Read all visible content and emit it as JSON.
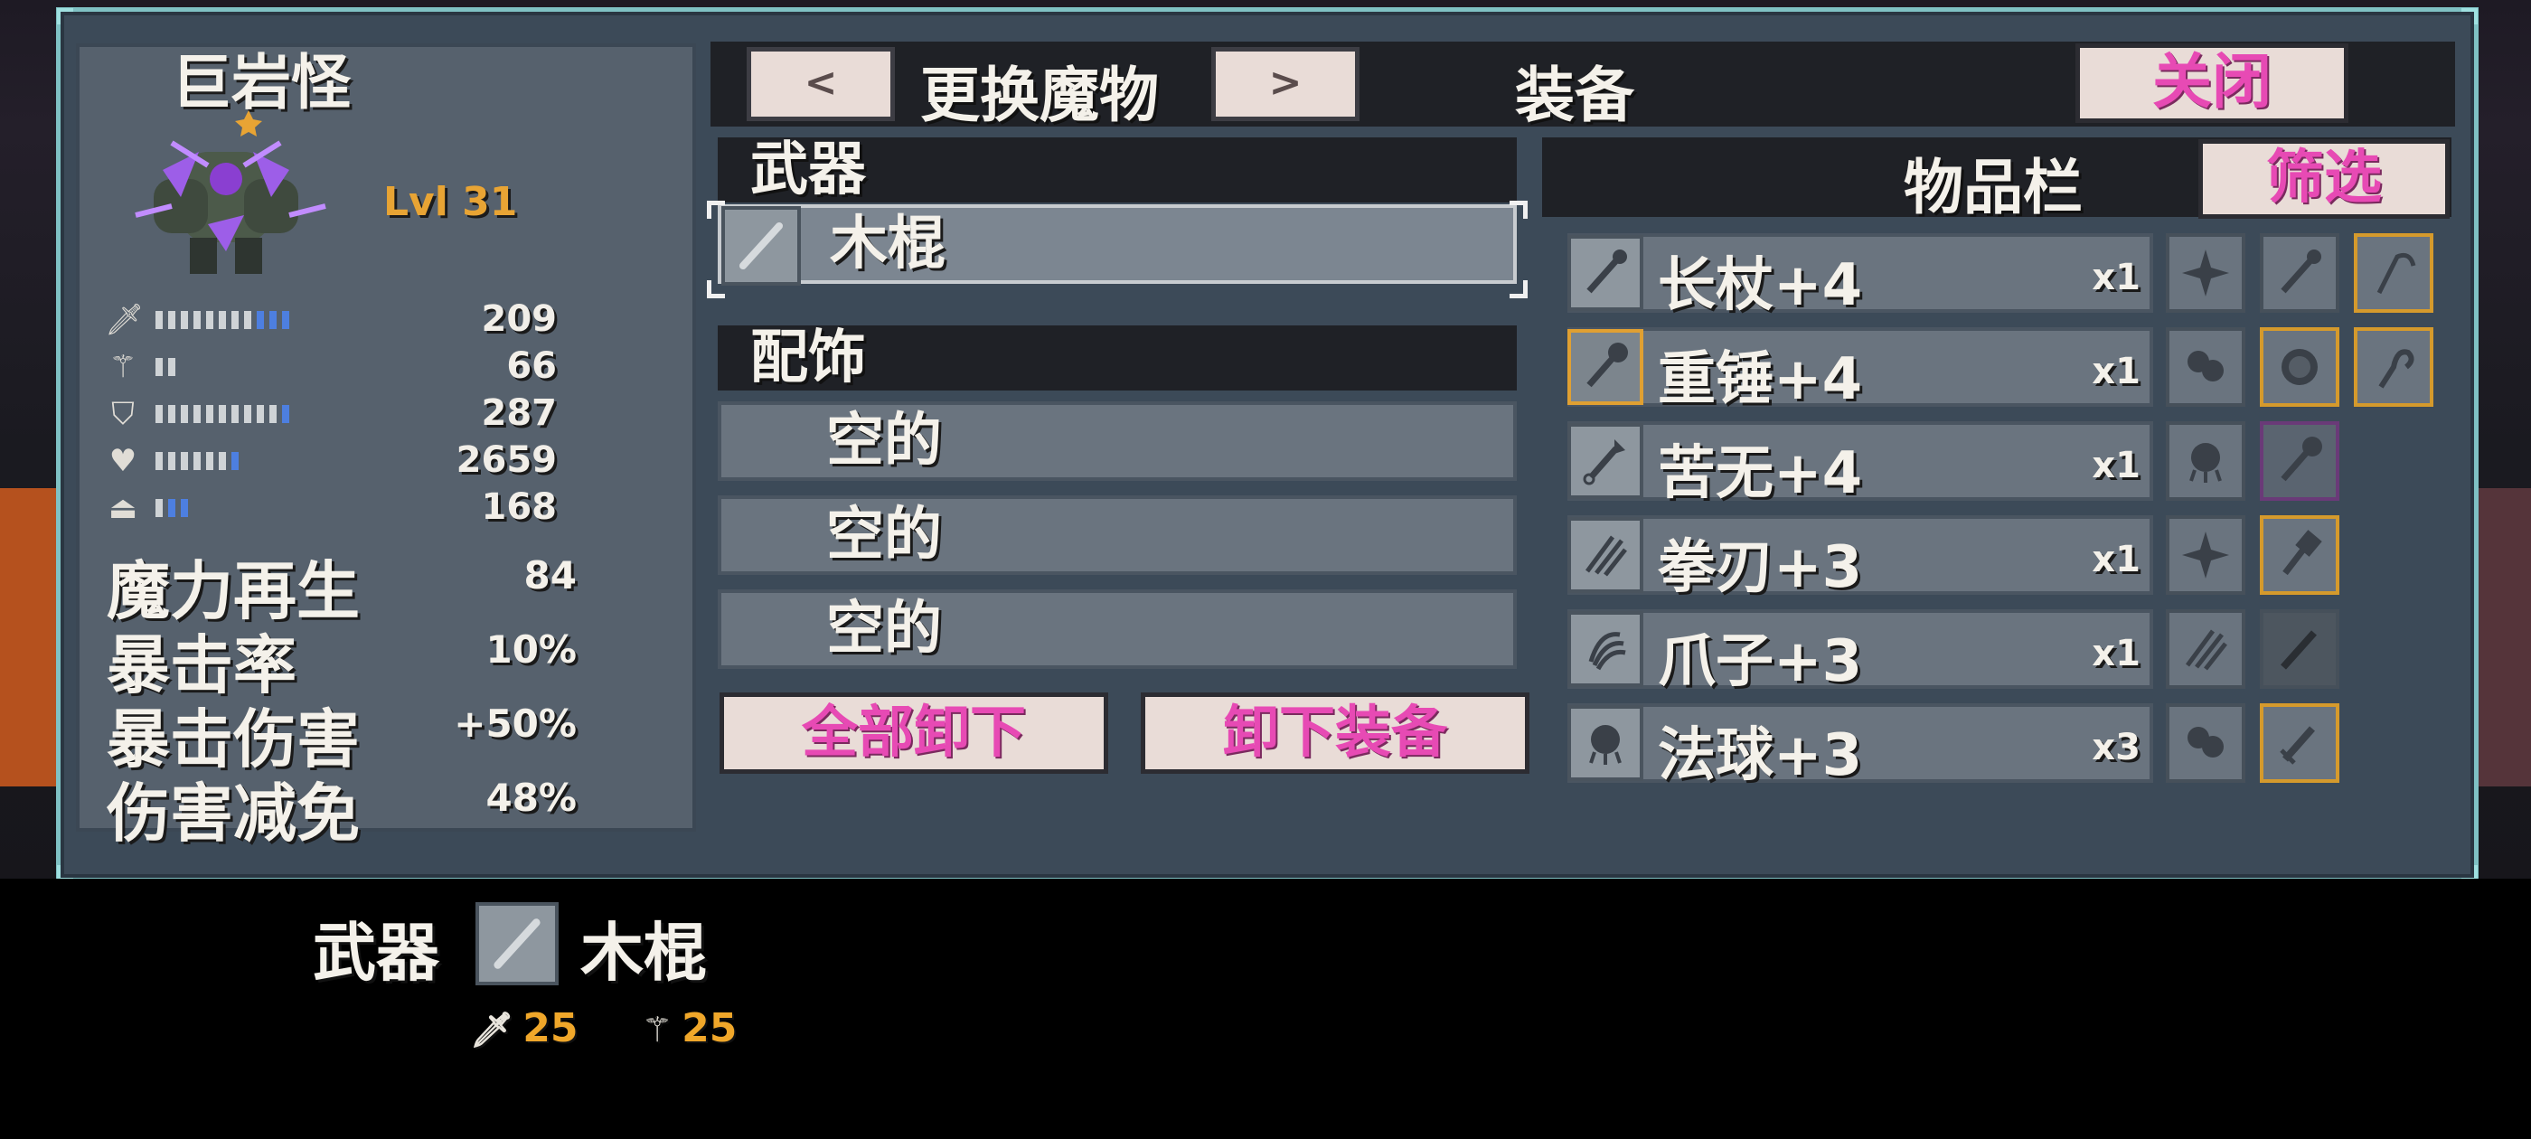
{
  "monster": {
    "name": "巨岩怪",
    "level": "Lvl 31",
    "stats": [
      {
        "icon": "sword-icon",
        "glyph": "🗡",
        "value": "209",
        "white": 8,
        "blue": 3
      },
      {
        "icon": "staff-icon",
        "glyph": "⚚",
        "value": "66",
        "white": 2,
        "blue": 0
      },
      {
        "icon": "shield-icon",
        "glyph": "⛉",
        "value": "287",
        "white": 10,
        "blue": 1
      },
      {
        "icon": "heart-icon",
        "glyph": "♥",
        "value": "2659",
        "white": 6,
        "blue": 1
      },
      {
        "icon": "potion-icon",
        "glyph": "⏏",
        "value": "168",
        "white": 1,
        "blue": 2
      }
    ],
    "text_stats": [
      {
        "label": "魔力再生",
        "value": "84"
      },
      {
        "label": "暴击率",
        "value": "10%"
      },
      {
        "label": "暴击伤害",
        "value": "+50%"
      },
      {
        "label": "伤害减免",
        "value": "48%"
      }
    ]
  },
  "topbar": {
    "prev_label": "<",
    "change_label": "更换魔物",
    "next_label": ">",
    "equip_label": "装备",
    "close_label": "关闭"
  },
  "weapon": {
    "header": "武器",
    "item": "木棍"
  },
  "accessory": {
    "header": "配饰",
    "slots": [
      "空的",
      "空的",
      "空的"
    ]
  },
  "actions": {
    "unequip_all": "全部卸下",
    "unequip": "卸下装备"
  },
  "inventory": {
    "title": "物品栏",
    "filter_label": "筛选",
    "items": [
      {
        "name": "长杖+4",
        "qty": "x1",
        "icon": "staff-icon"
      },
      {
        "name": "重锤+4",
        "qty": "x1",
        "icon": "mace-icon"
      },
      {
        "name": "苦无+4",
        "qty": "x1",
        "icon": "kunai-icon"
      },
      {
        "name": "拳刃+3",
        "qty": "x1",
        "icon": "katar-icon"
      },
      {
        "name": "爪子+3",
        "qty": "x1",
        "icon": "claw-icon"
      },
      {
        "name": "法球+3",
        "qty": "x3",
        "icon": "orb-icon"
      }
    ],
    "side_icons": [
      [
        "shuriken-icon",
        "staff-icon",
        "scythe-icon"
      ],
      [
        "cloth-icon",
        "shield-orb-icon",
        "hook-icon"
      ],
      [
        "orb-icon",
        "mace-icon"
      ],
      [
        "shuriken-icon",
        "hammer-icon"
      ],
      [
        "katar-icon",
        "sword-icon"
      ],
      [
        "cloth-icon",
        "dagger-icon"
      ]
    ]
  },
  "tooltip": {
    "category": "武器",
    "item": "木棍",
    "attack": "25",
    "magic": "25"
  }
}
